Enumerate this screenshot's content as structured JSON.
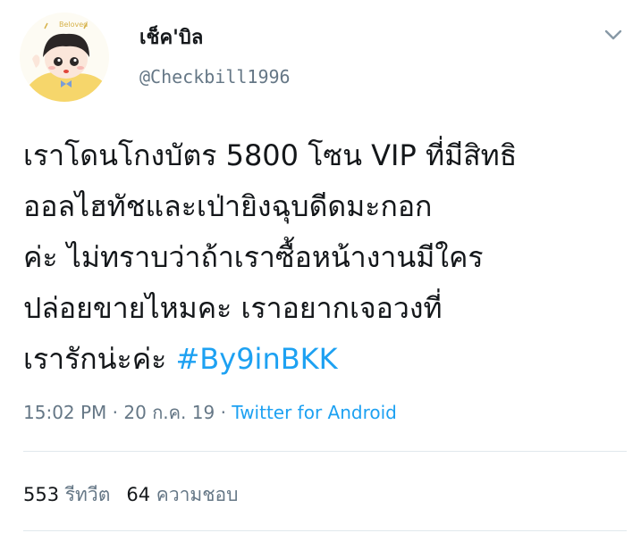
{
  "author": {
    "display_name": "เช็ค'บิล",
    "handle": "@Checkbill1996",
    "avatar_caption": "Beloved"
  },
  "tweet": {
    "lines": [
      "เราโดนโกงบัตร 5800 โซน VIP ที่มีสิทธิ",
      "ออลไฮทัชและเป่ายิงฉุบดีดมะกอก",
      "ค่ะ ไม่ทราบว่าถ้าเราซื้อหน้างานมีใคร",
      "ปล่อยขายไหมคะ เราอยากเจอวงที่"
    ],
    "last_line_text": "เรารักน่ะค่ะ ",
    "hashtag": "#By9inBKK"
  },
  "meta": {
    "time": "15:02 PM",
    "separator": " · ",
    "date": "20 ก.ค. 19",
    "source": "Twitter for Android"
  },
  "stats": {
    "retweets_count": "553",
    "retweets_label": "รีทวีต",
    "likes_count": "64",
    "likes_label": "ความชอบ"
  },
  "colors": {
    "link": "#1da1f2",
    "secondary_text": "#657786",
    "primary_text": "#14171a",
    "divider": "#e1e8ed"
  },
  "icons": {
    "caret": "chevron-down-icon",
    "avatar": "avatar"
  }
}
